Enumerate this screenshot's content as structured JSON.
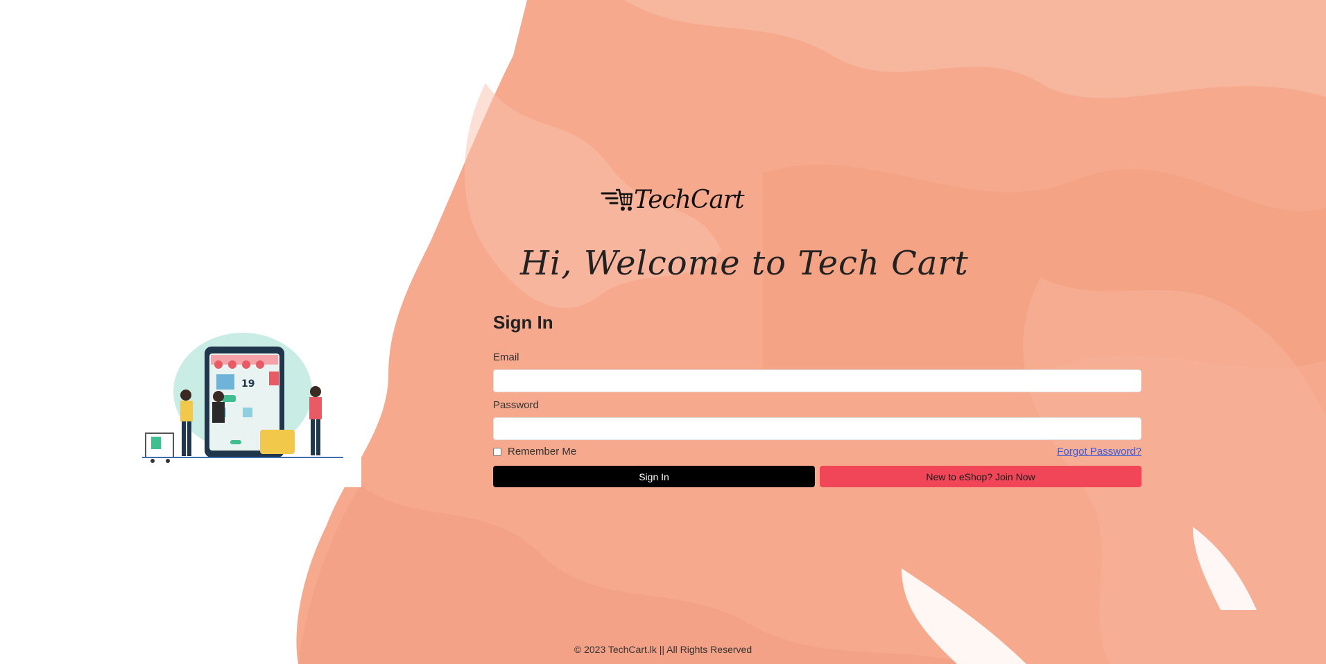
{
  "brand": {
    "logo_text": "TechCart",
    "logo_icon": "shopping-cart-icon"
  },
  "welcome": {
    "heading": "Hi, Welcome to Tech Cart"
  },
  "form": {
    "title": "Sign In",
    "email_label": "Email",
    "email_value": "",
    "password_label": "Password",
    "password_value": "",
    "remember_label": "Remember Me",
    "remember_checked": false,
    "forgot_link": "Forgot Password?",
    "signin_button": "Sign In",
    "join_button": "New to eShop? Join Now"
  },
  "footer": {
    "copyright": "© 2023 TechCart.lk || All Rights Reserved"
  },
  "colors": {
    "background_blobs": "#f6a98d",
    "signin_button": "#000000",
    "join_button": "#f14658",
    "link": "#3b5bdb"
  }
}
